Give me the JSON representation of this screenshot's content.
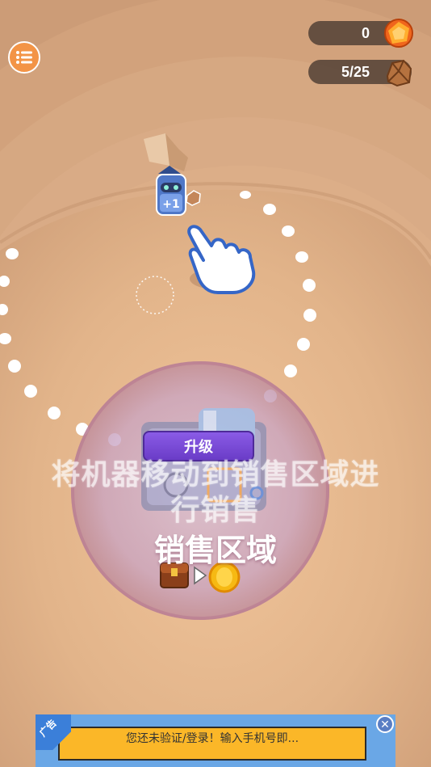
{
  "hud": {
    "coins": "0",
    "ore": "5/25",
    "coin_icon": "orange-gem-coin-icon",
    "ore_icon": "ore-rock-icon"
  },
  "menu": {
    "icon": "list-menu-icon"
  },
  "robot": {
    "badge": "+1"
  },
  "sell_zone": {
    "upgrade_label": "升级",
    "instruction": "将机器移动到销售区域进行销售",
    "instruction_line1": "将机器移动到销售区域进",
    "instruction_line2": "行销售",
    "title": "销售区域",
    "exchange_icons": [
      "treasure-chest-icon",
      "play-arrow-icon",
      "gold-coin-icon"
    ]
  },
  "ad": {
    "tag": "广告",
    "text": "您还未验证/登录！输入手机号即..."
  },
  "colors": {
    "sand": "#d4a47c",
    "accent_orange": "#f39446",
    "upgrade_purple": "#7a4bd6",
    "ad_yellow": "#fbb728",
    "ad_blue": "#6aa7e6"
  }
}
